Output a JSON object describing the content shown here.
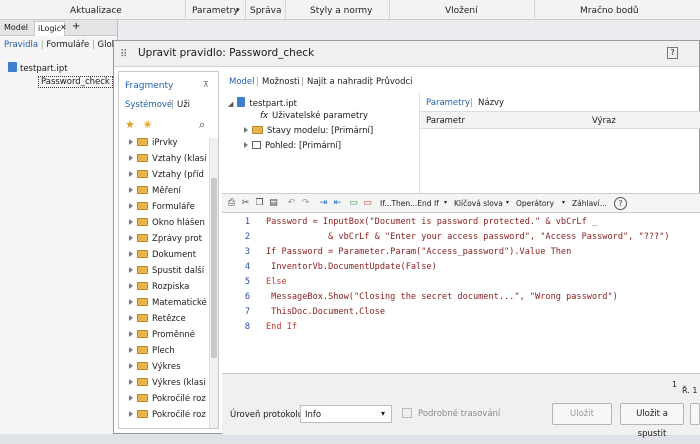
{
  "ribbon": {
    "groups": [
      "Aktualizace",
      "Parametry",
      "Správa",
      "Styly a normy",
      "Vložení",
      "Mračno bodů"
    ]
  },
  "left_panel": {
    "tabs": [
      "Model",
      "iLogic"
    ],
    "plus": "+",
    "sub_tabs": [
      "Pravidla",
      "Formuláře",
      "Glob"
    ],
    "tree_root": "testpart.ipt",
    "tree_rule": "Password_check"
  },
  "dialog": {
    "title": "Upravit pravidlo: Password_check",
    "help": "?",
    "fragments": {
      "title": "Fragmenty",
      "tabs": [
        "Systémové",
        "Uži"
      ],
      "items": [
        "iPrvky",
        "Vztahy (klasi",
        "Vztahy (příd",
        "Měření",
        "Formuláře",
        "Okno hlášen",
        "Zprávy prot",
        "Dokument",
        "Spustit další",
        "Rozpiska",
        "Matematické",
        "Řetězce",
        "Proměnné",
        "Plech",
        "Výkres",
        "Výkres (klasi",
        "Pokročilé roz",
        "Pokročilé roz"
      ]
    },
    "main_tabs": [
      "Model",
      "Možnosti",
      "Najít a nahradit",
      "Průvodci"
    ],
    "tree": {
      "root": "testpart.ipt",
      "items": [
        "Uživatelské parametry",
        "Stavy modelu: [Primární]",
        "Pohled: [Primární]"
      ]
    },
    "props": {
      "tabs": [
        "Parametry",
        "Názvy"
      ],
      "columns": [
        "Parametr",
        "Výraz"
      ]
    },
    "toolbar": {
      "ifthen": "If...Then...End If",
      "keywords": "Klíčová slova",
      "operators": "Operátory",
      "header": "Záhlaví..."
    },
    "code_lines": [
      {
        "n": "1",
        "text": "Password = InputBox(\"Document is password protected.\" & vbCrLf _"
      },
      {
        "n": "2",
        "text": "            & vbCrLf & \"Enter your access password\", \"Access Password\", \"???\")"
      },
      {
        "n": "3",
        "text": "If Password = Parameter.Param(\"Access_password\").Value Then"
      },
      {
        "n": "4",
        "text": " InventorVb.DocumentUpdate(False)"
      },
      {
        "n": "5",
        "text": "Else"
      },
      {
        "n": "6",
        "text": " MessageBox.Show(\"Closing the secret document...\", \"Wrong password\")"
      },
      {
        "n": "7",
        "text": " ThisDoc.Document.Close"
      },
      {
        "n": "8",
        "text": "End If"
      }
    ],
    "status": {
      "line": "1",
      "row": "Ř. 1"
    },
    "bottom": {
      "level_label": "Úroveň protokolu",
      "level_value": "Info",
      "trace": "Podrobné trasování",
      "save": "Uložit",
      "save_run": "Uložit a spustit"
    }
  }
}
